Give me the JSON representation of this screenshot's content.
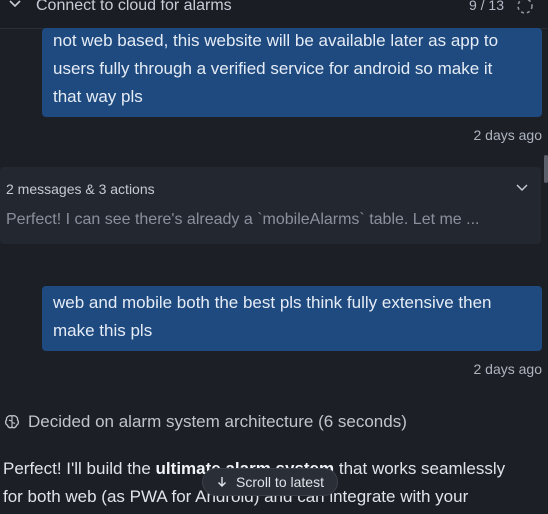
{
  "header": {
    "title": "Connect to cloud for alarms",
    "counter": "9 / 13"
  },
  "messages": [
    {
      "type": "user",
      "text": "not web based, this website will be available later as app to users fully through a verified service for android so make it that way pls",
      "lines": [
        "not web based, this website will be available later as app to",
        "users fully through a verified service for android so make it",
        "that way pls"
      ],
      "timestamp": "2 days ago"
    },
    {
      "type": "actions",
      "summary": "2 messages & 3 actions",
      "preview": "Perfect! I can see there's already a `mobileAlarms` table. Let me ..."
    },
    {
      "type": "user",
      "lines": [
        "web and mobile both the best pls think fully extensive then",
        "make this pls"
      ],
      "timestamp": "2 days ago"
    },
    {
      "type": "thinking",
      "label": "Decided on alarm system architecture (6 seconds)"
    },
    {
      "type": "assistant",
      "line1_prefix": "Perfect! I'll build the ",
      "line1_bold": "ultimate alarm system",
      "line1_suffix": " that works seamlessly",
      "line2": "for both web (as PWA for Android) and can integrate with your"
    }
  ],
  "scroll_button": {
    "label": "Scroll to latest"
  },
  "colors": {
    "background": "#1c1f26",
    "user_bubble": "#1e4a80",
    "actions_card": "#23272f"
  }
}
